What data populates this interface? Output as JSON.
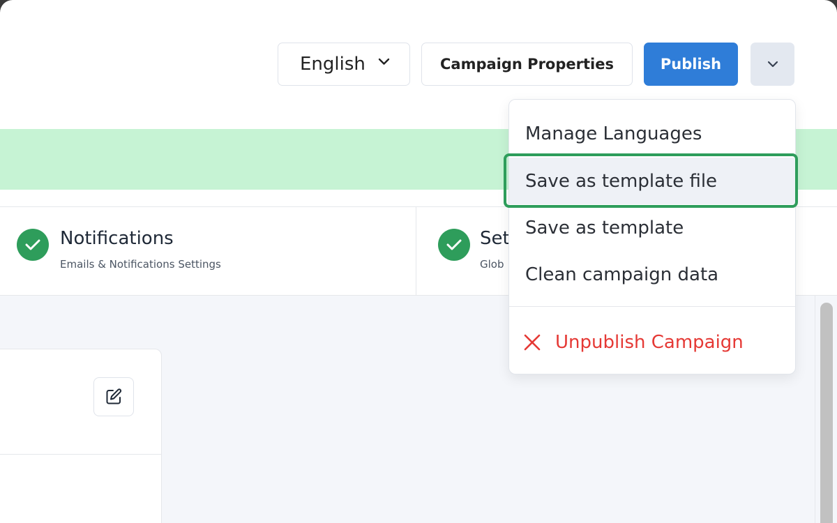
{
  "header": {
    "language_label": "English",
    "campaign_properties_label": "Campaign Properties",
    "publish_label": "Publish"
  },
  "steps": [
    {
      "title": "Notifications",
      "subtitle": "Emails & Notifications Settings",
      "status": "complete"
    },
    {
      "title": "Set",
      "subtitle": "Glob",
      "status": "complete"
    }
  ],
  "menu": {
    "items": [
      {
        "label": "Manage Languages"
      },
      {
        "label": "Save as template file"
      },
      {
        "label": "Save as template"
      },
      {
        "label": "Clean campaign data"
      }
    ],
    "danger_item": {
      "label": "Unpublish Campaign"
    }
  },
  "colors": {
    "primary": "#2f7dd8",
    "success": "#2e9d5b",
    "banner": "#c6f3d4",
    "danger": "#e53935"
  }
}
